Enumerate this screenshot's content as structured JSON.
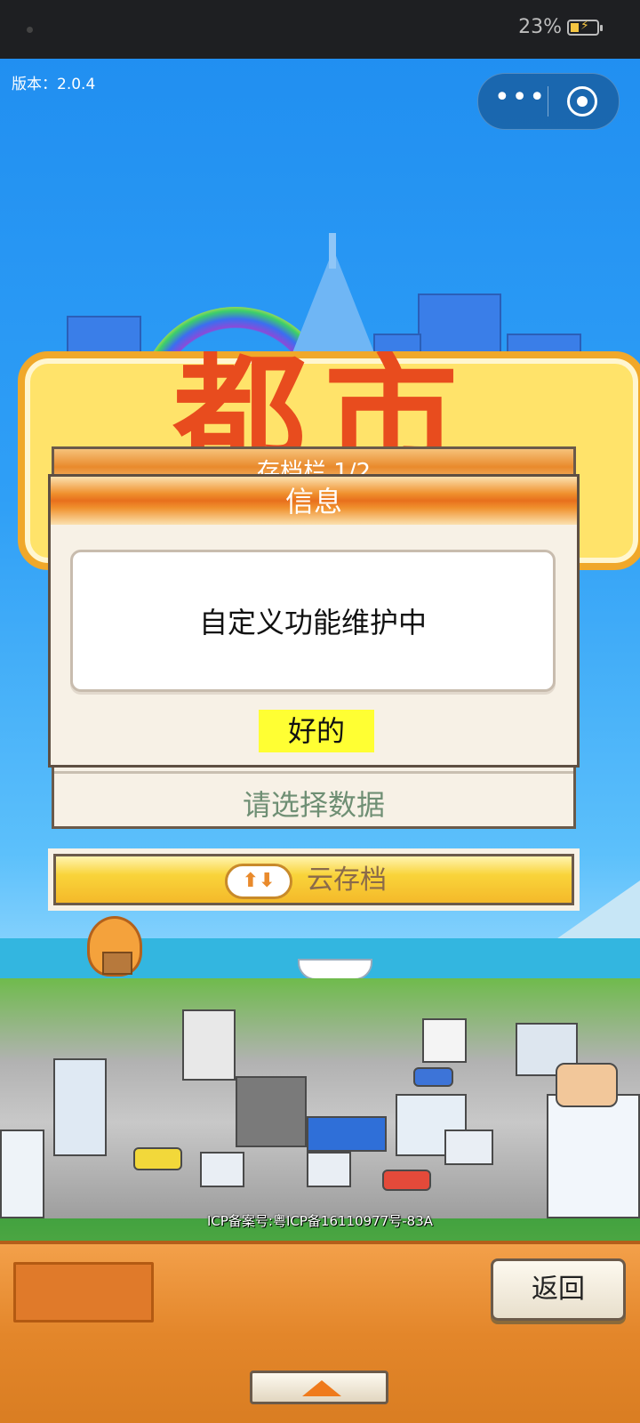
{
  "status_bar": {
    "battery_percent": "23%",
    "battery_level": 0.23
  },
  "version": "版本：2.0.4",
  "capsule": {
    "more_icon": "more-dots-icon",
    "close_icon": "target-circle-icon"
  },
  "title_art": {
    "glyphs": "都市"
  },
  "save_dialog": {
    "title": "存档栏 1/2",
    "select_label": "请选择数据",
    "cloud_label": "云存档"
  },
  "info_dialog": {
    "title": "信息",
    "message": "自定义功能维护中",
    "ok_label": "好的"
  },
  "footer": {
    "icp": "ICP备案号:粤ICP备16110977号-83A",
    "back_label": "返回",
    "expand_icon": "arrow-up-icon"
  },
  "colors": {
    "sky": "#2f9ff6",
    "dialog_header": "#e86f1c",
    "ok_highlight": "#ffff33",
    "bottom_bar": "#e3862a"
  }
}
